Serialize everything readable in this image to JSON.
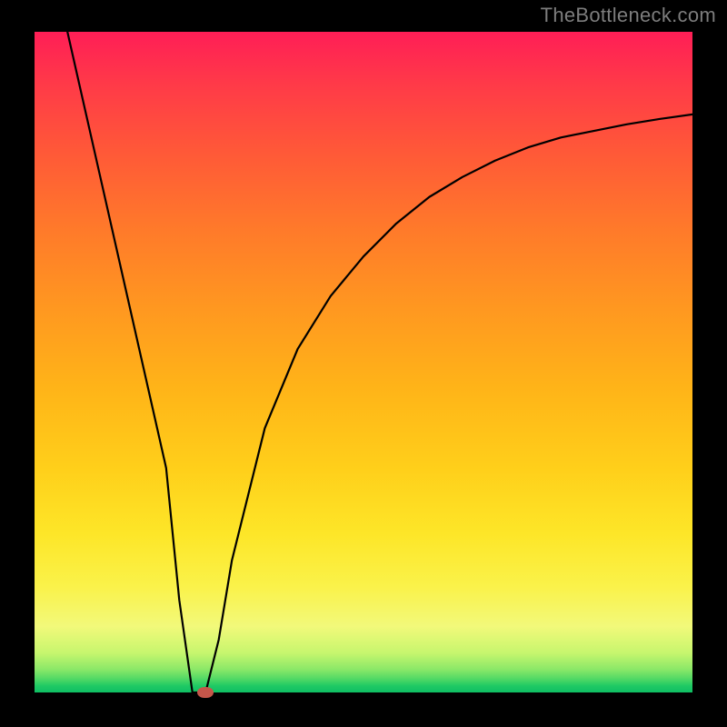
{
  "watermark": "TheBottleneck.com",
  "colors": {
    "curve": "#000000",
    "marker": "#c5564a",
    "frame": "#000000"
  },
  "chart_data": {
    "type": "line",
    "title": "",
    "xlabel": "",
    "ylabel": "",
    "xlim": [
      0,
      100
    ],
    "ylim": [
      0,
      100
    ],
    "grid": false,
    "legend": false,
    "series": [
      {
        "name": "bottleneck-curve",
        "x": [
          5,
          10,
          15,
          20,
          22,
          24,
          26,
          28,
          30,
          35,
          40,
          45,
          50,
          55,
          60,
          65,
          70,
          75,
          80,
          85,
          90,
          95,
          100
        ],
        "y": [
          100,
          78,
          56,
          34,
          14,
          0,
          0,
          8,
          20,
          40,
          52,
          60,
          66,
          71,
          75,
          78,
          80.5,
          82.5,
          84,
          85,
          86,
          86.8,
          87.5
        ]
      }
    ],
    "marker": {
      "x": 26,
      "y": 0
    }
  }
}
